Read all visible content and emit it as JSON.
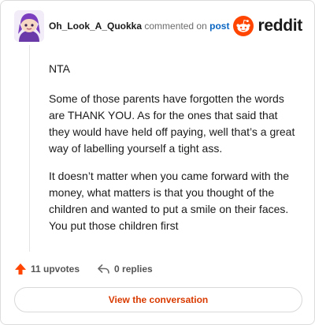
{
  "header": {
    "username": "Oh_Look_A_Quokka",
    "verb": "commented on",
    "post_link": "post",
    "brand": "reddit"
  },
  "comment": {
    "paragraphs": [
      "NTA",
      "Some of those parents have forgotten the words are THANK YOU. As for the ones that said that they would have held off paying, well that’s a great way of labelling yourself a tight ass.",
      "It doesn’t matter when you came forward with the money, what matters is that you thought of the children and wanted to put a smile on their faces. You put those children first"
    ]
  },
  "actions": {
    "upvotes": "11 upvotes",
    "replies": "0 replies"
  },
  "cta": {
    "label": "View the conversation"
  },
  "colors": {
    "accent": "#ff4500",
    "link": "#0a66c2",
    "cta_text": "#d93a00"
  }
}
